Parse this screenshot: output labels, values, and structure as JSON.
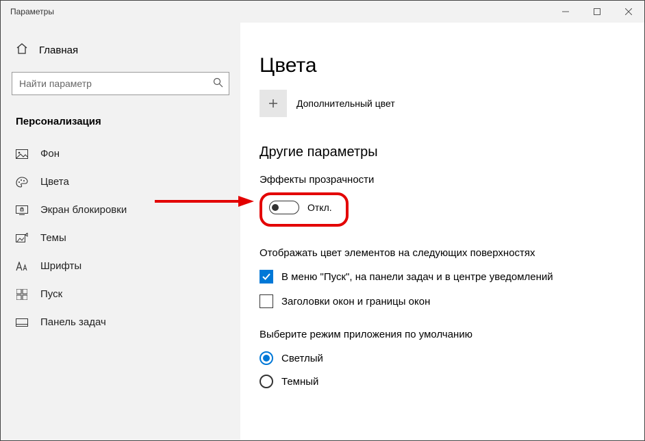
{
  "window": {
    "title": "Параметры"
  },
  "sidebar": {
    "home_label": "Главная",
    "search_placeholder": "Найти параметр",
    "section_label": "Персонализация",
    "items": [
      {
        "label": "Фон"
      },
      {
        "label": "Цвета"
      },
      {
        "label": "Экран блокировки"
      },
      {
        "label": "Темы"
      },
      {
        "label": "Шрифты"
      },
      {
        "label": "Пуск"
      },
      {
        "label": "Панель задач"
      }
    ]
  },
  "main": {
    "page_title": "Цвета",
    "add_color_label": "Дополнительный цвет",
    "other_params_heading": "Другие параметры",
    "transparency_label": "Эффекты прозрачности",
    "toggle_state_label": "Откл.",
    "surfaces_label": "Отображать цвет элементов на следующих поверхностях",
    "check_start_label": "В меню \"Пуск\", на панели задач и в центре уведомлений",
    "check_titlebars_label": "Заголовки окон и границы окон",
    "appmode_label": "Выберите режим приложения по умолчанию",
    "radio_light_label": "Светлый",
    "radio_dark_label": "Темный"
  }
}
